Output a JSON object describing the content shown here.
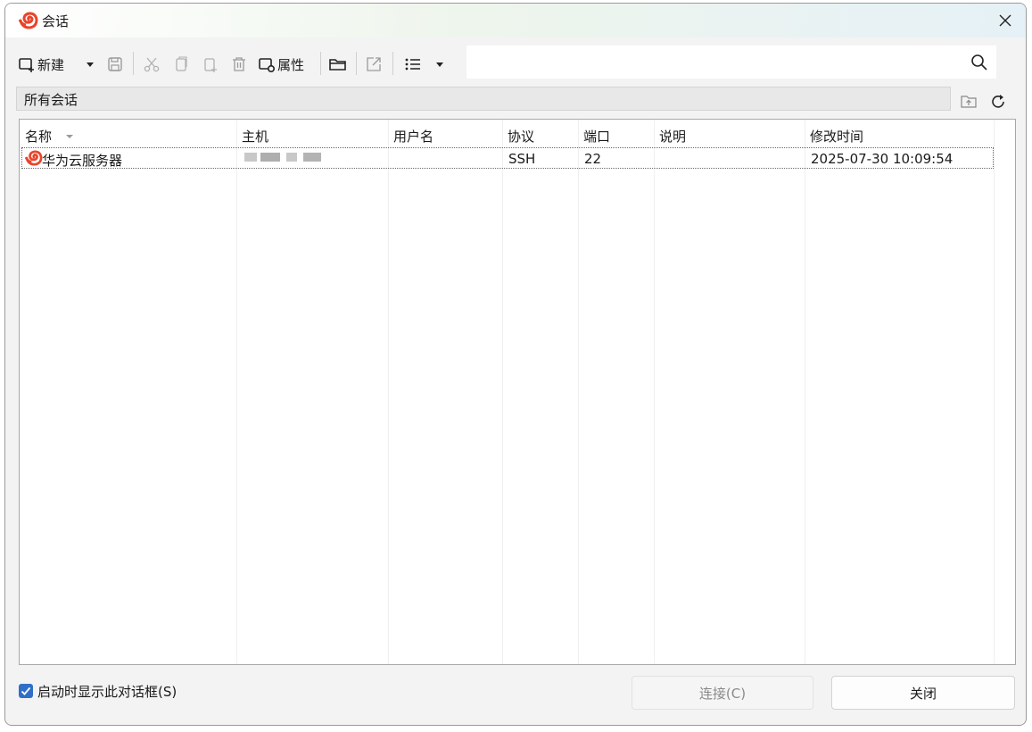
{
  "window": {
    "title": "会话"
  },
  "toolbar": {
    "new_label": "新建",
    "properties_label": "属性",
    "icons": [
      "new-session-icon",
      "dropdown-arrow-icon",
      "save-icon",
      "cut-icon",
      "copy-icon",
      "paste-icon",
      "delete-icon",
      "properties-icon",
      "open-folder-icon",
      "export-icon",
      "list-view-icon",
      "dropdown-arrow-icon"
    ]
  },
  "search": {
    "value": "",
    "placeholder": ""
  },
  "path": {
    "label": "所有会话"
  },
  "table": {
    "columns": [
      "名称",
      "主机",
      "用户名",
      "协议",
      "端口",
      "说明",
      "修改时间"
    ],
    "rows": [
      {
        "name": "华为云服务器",
        "host": "",
        "username": "",
        "protocol": "SSH",
        "port": "22",
        "description": "",
        "modified": "2025-07-30 10:09:54"
      }
    ]
  },
  "footer": {
    "show_on_startup_label": "启动时显示此对话框(S)",
    "show_on_startup_checked": true,
    "connect_label": "连接(C)",
    "close_label": "关闭"
  },
  "colors": {
    "accent": "#2f6fc7",
    "logo": "#e8452c"
  }
}
